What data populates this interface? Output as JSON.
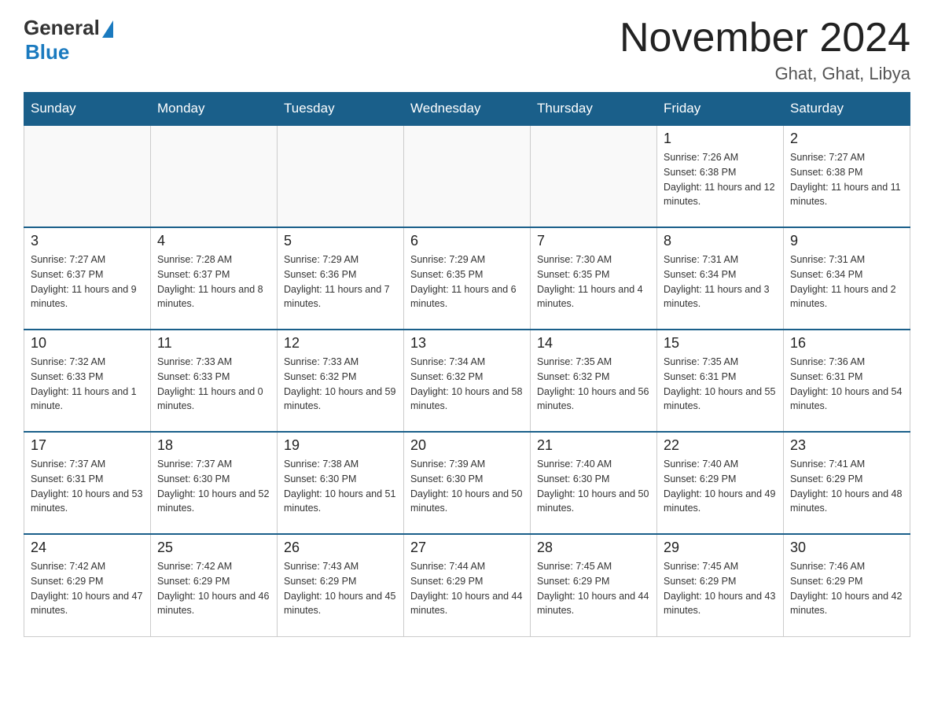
{
  "header": {
    "logo_general": "General",
    "logo_blue": "Blue",
    "month_year": "November 2024",
    "location": "Ghat, Ghat, Libya"
  },
  "days_of_week": [
    "Sunday",
    "Monday",
    "Tuesday",
    "Wednesday",
    "Thursday",
    "Friday",
    "Saturday"
  ],
  "weeks": [
    [
      {
        "day": "",
        "info": ""
      },
      {
        "day": "",
        "info": ""
      },
      {
        "day": "",
        "info": ""
      },
      {
        "day": "",
        "info": ""
      },
      {
        "day": "",
        "info": ""
      },
      {
        "day": "1",
        "info": "Sunrise: 7:26 AM\nSunset: 6:38 PM\nDaylight: 11 hours and 12 minutes."
      },
      {
        "day": "2",
        "info": "Sunrise: 7:27 AM\nSunset: 6:38 PM\nDaylight: 11 hours and 11 minutes."
      }
    ],
    [
      {
        "day": "3",
        "info": "Sunrise: 7:27 AM\nSunset: 6:37 PM\nDaylight: 11 hours and 9 minutes."
      },
      {
        "day": "4",
        "info": "Sunrise: 7:28 AM\nSunset: 6:37 PM\nDaylight: 11 hours and 8 minutes."
      },
      {
        "day": "5",
        "info": "Sunrise: 7:29 AM\nSunset: 6:36 PM\nDaylight: 11 hours and 7 minutes."
      },
      {
        "day": "6",
        "info": "Sunrise: 7:29 AM\nSunset: 6:35 PM\nDaylight: 11 hours and 6 minutes."
      },
      {
        "day": "7",
        "info": "Sunrise: 7:30 AM\nSunset: 6:35 PM\nDaylight: 11 hours and 4 minutes."
      },
      {
        "day": "8",
        "info": "Sunrise: 7:31 AM\nSunset: 6:34 PM\nDaylight: 11 hours and 3 minutes."
      },
      {
        "day": "9",
        "info": "Sunrise: 7:31 AM\nSunset: 6:34 PM\nDaylight: 11 hours and 2 minutes."
      }
    ],
    [
      {
        "day": "10",
        "info": "Sunrise: 7:32 AM\nSunset: 6:33 PM\nDaylight: 11 hours and 1 minute."
      },
      {
        "day": "11",
        "info": "Sunrise: 7:33 AM\nSunset: 6:33 PM\nDaylight: 11 hours and 0 minutes."
      },
      {
        "day": "12",
        "info": "Sunrise: 7:33 AM\nSunset: 6:32 PM\nDaylight: 10 hours and 59 minutes."
      },
      {
        "day": "13",
        "info": "Sunrise: 7:34 AM\nSunset: 6:32 PM\nDaylight: 10 hours and 58 minutes."
      },
      {
        "day": "14",
        "info": "Sunrise: 7:35 AM\nSunset: 6:32 PM\nDaylight: 10 hours and 56 minutes."
      },
      {
        "day": "15",
        "info": "Sunrise: 7:35 AM\nSunset: 6:31 PM\nDaylight: 10 hours and 55 minutes."
      },
      {
        "day": "16",
        "info": "Sunrise: 7:36 AM\nSunset: 6:31 PM\nDaylight: 10 hours and 54 minutes."
      }
    ],
    [
      {
        "day": "17",
        "info": "Sunrise: 7:37 AM\nSunset: 6:31 PM\nDaylight: 10 hours and 53 minutes."
      },
      {
        "day": "18",
        "info": "Sunrise: 7:37 AM\nSunset: 6:30 PM\nDaylight: 10 hours and 52 minutes."
      },
      {
        "day": "19",
        "info": "Sunrise: 7:38 AM\nSunset: 6:30 PM\nDaylight: 10 hours and 51 minutes."
      },
      {
        "day": "20",
        "info": "Sunrise: 7:39 AM\nSunset: 6:30 PM\nDaylight: 10 hours and 50 minutes."
      },
      {
        "day": "21",
        "info": "Sunrise: 7:40 AM\nSunset: 6:30 PM\nDaylight: 10 hours and 50 minutes."
      },
      {
        "day": "22",
        "info": "Sunrise: 7:40 AM\nSunset: 6:29 PM\nDaylight: 10 hours and 49 minutes."
      },
      {
        "day": "23",
        "info": "Sunrise: 7:41 AM\nSunset: 6:29 PM\nDaylight: 10 hours and 48 minutes."
      }
    ],
    [
      {
        "day": "24",
        "info": "Sunrise: 7:42 AM\nSunset: 6:29 PM\nDaylight: 10 hours and 47 minutes."
      },
      {
        "day": "25",
        "info": "Sunrise: 7:42 AM\nSunset: 6:29 PM\nDaylight: 10 hours and 46 minutes."
      },
      {
        "day": "26",
        "info": "Sunrise: 7:43 AM\nSunset: 6:29 PM\nDaylight: 10 hours and 45 minutes."
      },
      {
        "day": "27",
        "info": "Sunrise: 7:44 AM\nSunset: 6:29 PM\nDaylight: 10 hours and 44 minutes."
      },
      {
        "day": "28",
        "info": "Sunrise: 7:45 AM\nSunset: 6:29 PM\nDaylight: 10 hours and 44 minutes."
      },
      {
        "day": "29",
        "info": "Sunrise: 7:45 AM\nSunset: 6:29 PM\nDaylight: 10 hours and 43 minutes."
      },
      {
        "day": "30",
        "info": "Sunrise: 7:46 AM\nSunset: 6:29 PM\nDaylight: 10 hours and 42 minutes."
      }
    ]
  ]
}
